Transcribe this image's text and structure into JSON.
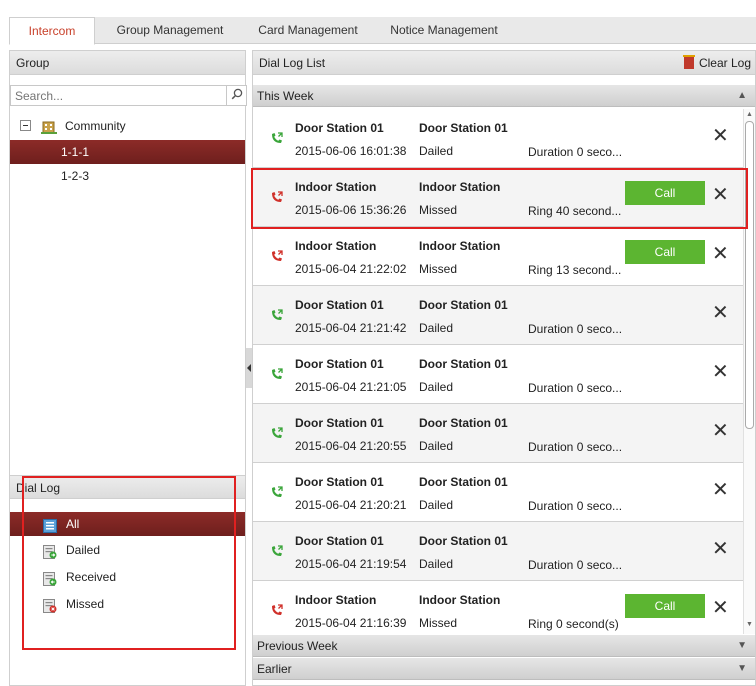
{
  "tabs": [
    {
      "label": "Intercom",
      "active": true
    },
    {
      "label": "Group Management"
    },
    {
      "label": "Card Management"
    },
    {
      "label": "Notice Management"
    }
  ],
  "group": {
    "title": "Group",
    "search_placeholder": "Search...",
    "tree": [
      {
        "label": "Community"
      },
      {
        "label": "1-1-1",
        "selected": true
      },
      {
        "label": "1-2-3"
      }
    ]
  },
  "dial_log": {
    "title": "Dial Log",
    "items": [
      {
        "label": "All",
        "selected": true,
        "icon": "list-icon"
      },
      {
        "label": "Dailed",
        "icon": "dialed-icon"
      },
      {
        "label": "Received",
        "icon": "received-icon"
      },
      {
        "label": "Missed",
        "icon": "missed-icon"
      }
    ]
  },
  "list": {
    "title": "Dial Log List",
    "clear_label": "Clear Log",
    "sections": {
      "this_week": "This Week",
      "previous_week": "Previous Week",
      "earlier": "Earlier"
    },
    "call_label": "Call",
    "delete_glyph": "✕",
    "rows": [
      {
        "name": "Door Station 01",
        "device": "Door Station 01",
        "time": "2015-06-06 16:01:38",
        "type": "Dailed",
        "duration": "Duration 0 seco...",
        "status": "dialed",
        "call": false
      },
      {
        "name": "Indoor Station",
        "device": "Indoor Station",
        "time": "2015-06-06 15:36:26",
        "type": "Missed",
        "duration": "Ring 40 second...",
        "status": "missed",
        "call": true
      },
      {
        "name": "Indoor Station",
        "device": "Indoor Station",
        "time": "2015-06-04 21:22:02",
        "type": "Missed",
        "duration": "Ring 13 second...",
        "status": "missed",
        "call": true
      },
      {
        "name": "Door Station 01",
        "device": "Door Station 01",
        "time": "2015-06-04 21:21:42",
        "type": "Dailed",
        "duration": "Duration 0 seco...",
        "status": "dialed",
        "call": false
      },
      {
        "name": "Door Station 01",
        "device": "Door Station 01",
        "time": "2015-06-04 21:21:05",
        "type": "Dailed",
        "duration": "Duration 0 seco...",
        "status": "dialed",
        "call": false
      },
      {
        "name": "Door Station 01",
        "device": "Door Station 01",
        "time": "2015-06-04 21:20:55",
        "type": "Dailed",
        "duration": "Duration 0 seco...",
        "status": "dialed",
        "call": false
      },
      {
        "name": "Door Station 01",
        "device": "Door Station 01",
        "time": "2015-06-04 21:20:21",
        "type": "Dailed",
        "duration": "Duration 0 seco...",
        "status": "dialed",
        "call": false
      },
      {
        "name": "Door Station 01",
        "device": "Door Station 01",
        "time": "2015-06-04 21:19:54",
        "type": "Dailed",
        "duration": "Duration 0 seco...",
        "status": "dialed",
        "call": false
      },
      {
        "name": "Indoor Station",
        "device": "Indoor Station",
        "time": "2015-06-04 21:16:39",
        "type": "Missed",
        "duration": "Ring 0 second(s)",
        "status": "missed",
        "call": true
      }
    ]
  },
  "colors": {
    "accent": "#7a2421",
    "call_green": "#5cb531",
    "dialed_green": "#3aa53a",
    "missed_red": "#d0302a",
    "highlight": "#e02020"
  }
}
